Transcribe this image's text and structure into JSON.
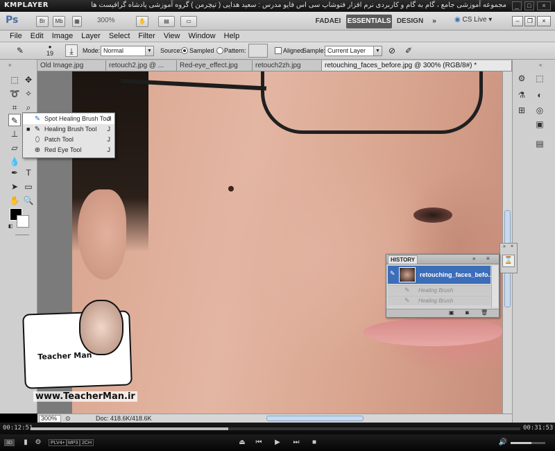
{
  "kmplayer": {
    "logo": "KMPLAYER",
    "video_title": "مجموعه آموزشی جامع ، گام به گام و کاربردی نرم افزار فتوشاپ سی اس فایو  مدرس : سعید هدایی ( تیچرمن ) گروه آموزشی پادشاه گرافیست ها",
    "time_elapsed": "00:12:51",
    "time_total": "00:31:53",
    "seek_fraction": 0.403,
    "volume_fraction": 0.6,
    "badges": [
      "3D",
      "PLV4+",
      "MP3",
      "2CH"
    ]
  },
  "photoshop": {
    "logo": "Ps",
    "appbar_buttons": [
      "Br",
      "Mb"
    ],
    "zoom_level": "300%",
    "workspaces": [
      "FADAEI",
      "ESSENTIALS",
      "DESIGN"
    ],
    "workspace_more": "»",
    "cs_live": "CS Live"
  },
  "menu": [
    "File",
    "Edit",
    "Image",
    "Layer",
    "Select",
    "Filter",
    "View",
    "Window",
    "Help"
  ],
  "options": {
    "brush_size": "19",
    "mode_label": "Mode:",
    "mode_value": "Normal",
    "source_label": "Source:",
    "sampled_label": "Sampled",
    "pattern_label": "Pattern:",
    "aligned_label": "Aligned",
    "sample_label": "Sample:",
    "sample_value": "Current Layer"
  },
  "doc_tabs": [
    {
      "label": "Old Image.jpg"
    },
    {
      "label": "retouch2.jpg @ ..."
    },
    {
      "label": "Red-eye_effect.jpg"
    },
    {
      "label": "retouch2zh.jpg"
    },
    {
      "label": "retouching_faces_before.jpg @ 300% (RGB/8#) *"
    }
  ],
  "flyout": [
    {
      "label": "Spot Healing Brush Tool",
      "key": "J",
      "icon": "spot-healing-icon"
    },
    {
      "label": "Healing Brush Tool",
      "key": "J",
      "icon": "healing-brush-icon"
    },
    {
      "label": "Patch Tool",
      "key": "J",
      "icon": "patch-icon"
    },
    {
      "label": "Red Eye Tool",
      "key": "J",
      "icon": "red-eye-icon"
    }
  ],
  "status": {
    "zoom": "300%",
    "doc": "Doc: 418.6K/418.6K"
  },
  "history": {
    "tab": "HISTORY",
    "snapshot": "retouching_faces_befo...",
    "states": [
      "Healing Brush",
      "Healing Brush"
    ]
  },
  "watermark": {
    "brand": "Teacher Man",
    "url": "www.TeacherMan.ir"
  },
  "colors": {
    "selection_blue": "#3c6db8",
    "foreground": "#000000",
    "background": "#ffffff"
  }
}
